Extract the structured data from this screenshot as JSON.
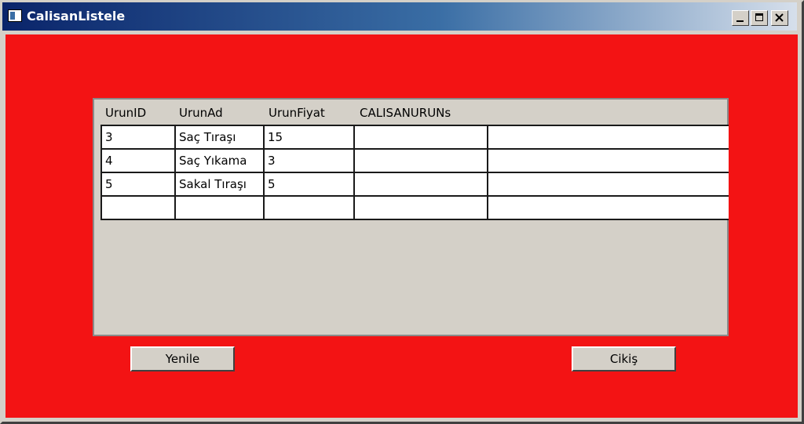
{
  "window": {
    "title": "CalisanListele",
    "controls": [
      "minimize",
      "maximize",
      "close"
    ]
  },
  "grid": {
    "columns": [
      "UrunID",
      "UrunAd",
      "UrunFiyat",
      "CALISANURUNs"
    ],
    "rows": [
      [
        "3",
        "Saç Tıraşı",
        "15",
        "",
        ""
      ],
      [
        "4",
        "Saç Yıkama",
        "3",
        "",
        ""
      ],
      [
        "5",
        "Sakal Tıraşı",
        "5",
        "",
        ""
      ],
      [
        "",
        "",
        "",
        "",
        ""
      ]
    ]
  },
  "buttons": {
    "refresh": "Yenile",
    "exit": "Cikiş"
  },
  "colors": {
    "background": "#f31314",
    "titlebar_start": "#0a246a",
    "grid_bg": "#d4d0c8"
  }
}
